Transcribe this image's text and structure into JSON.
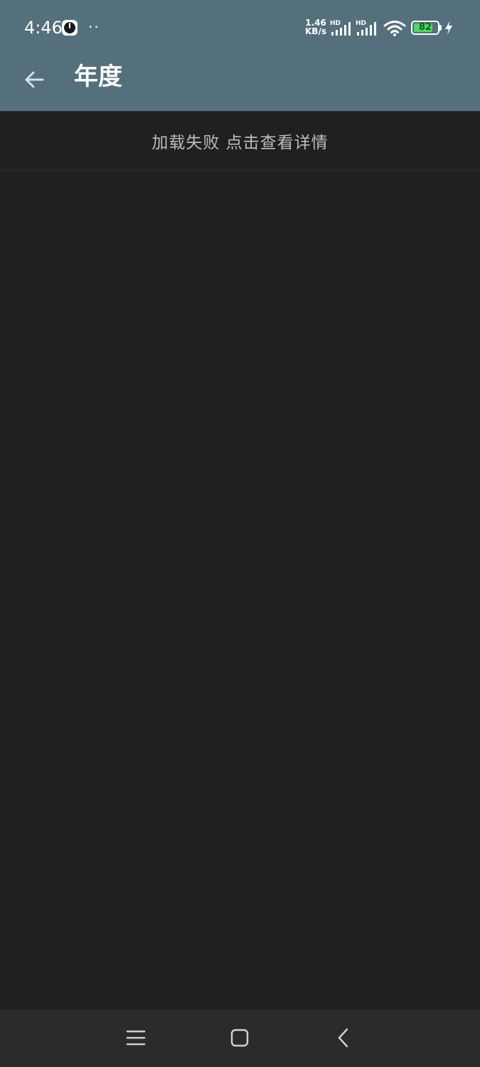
{
  "status_bar": {
    "time": "4:46",
    "dots": "··",
    "net_speed_value": "1.46",
    "net_speed_unit": "KB/s",
    "signal_label_1": "HD",
    "signal_label_2": "HD",
    "battery_level": "82",
    "battery_fraction": 0.82,
    "icons": [
      "clock-icon",
      "signal-icon",
      "wifi-icon",
      "battery-icon",
      "charging-bolt-icon"
    ]
  },
  "toolbar": {
    "back_icon": "arrow-left-icon",
    "title": "年度"
  },
  "error_banner": {
    "text": "加载失败 点击查看详情"
  },
  "nav_bar": {
    "icons": [
      "menu-icon",
      "home-icon",
      "back-chevron-icon"
    ]
  },
  "colors": {
    "header": "#54707c",
    "background": "#202020",
    "nav_bar": "#2b2b2b",
    "error_text": "#bdbdbd",
    "battery_fill": "#4cd964"
  }
}
